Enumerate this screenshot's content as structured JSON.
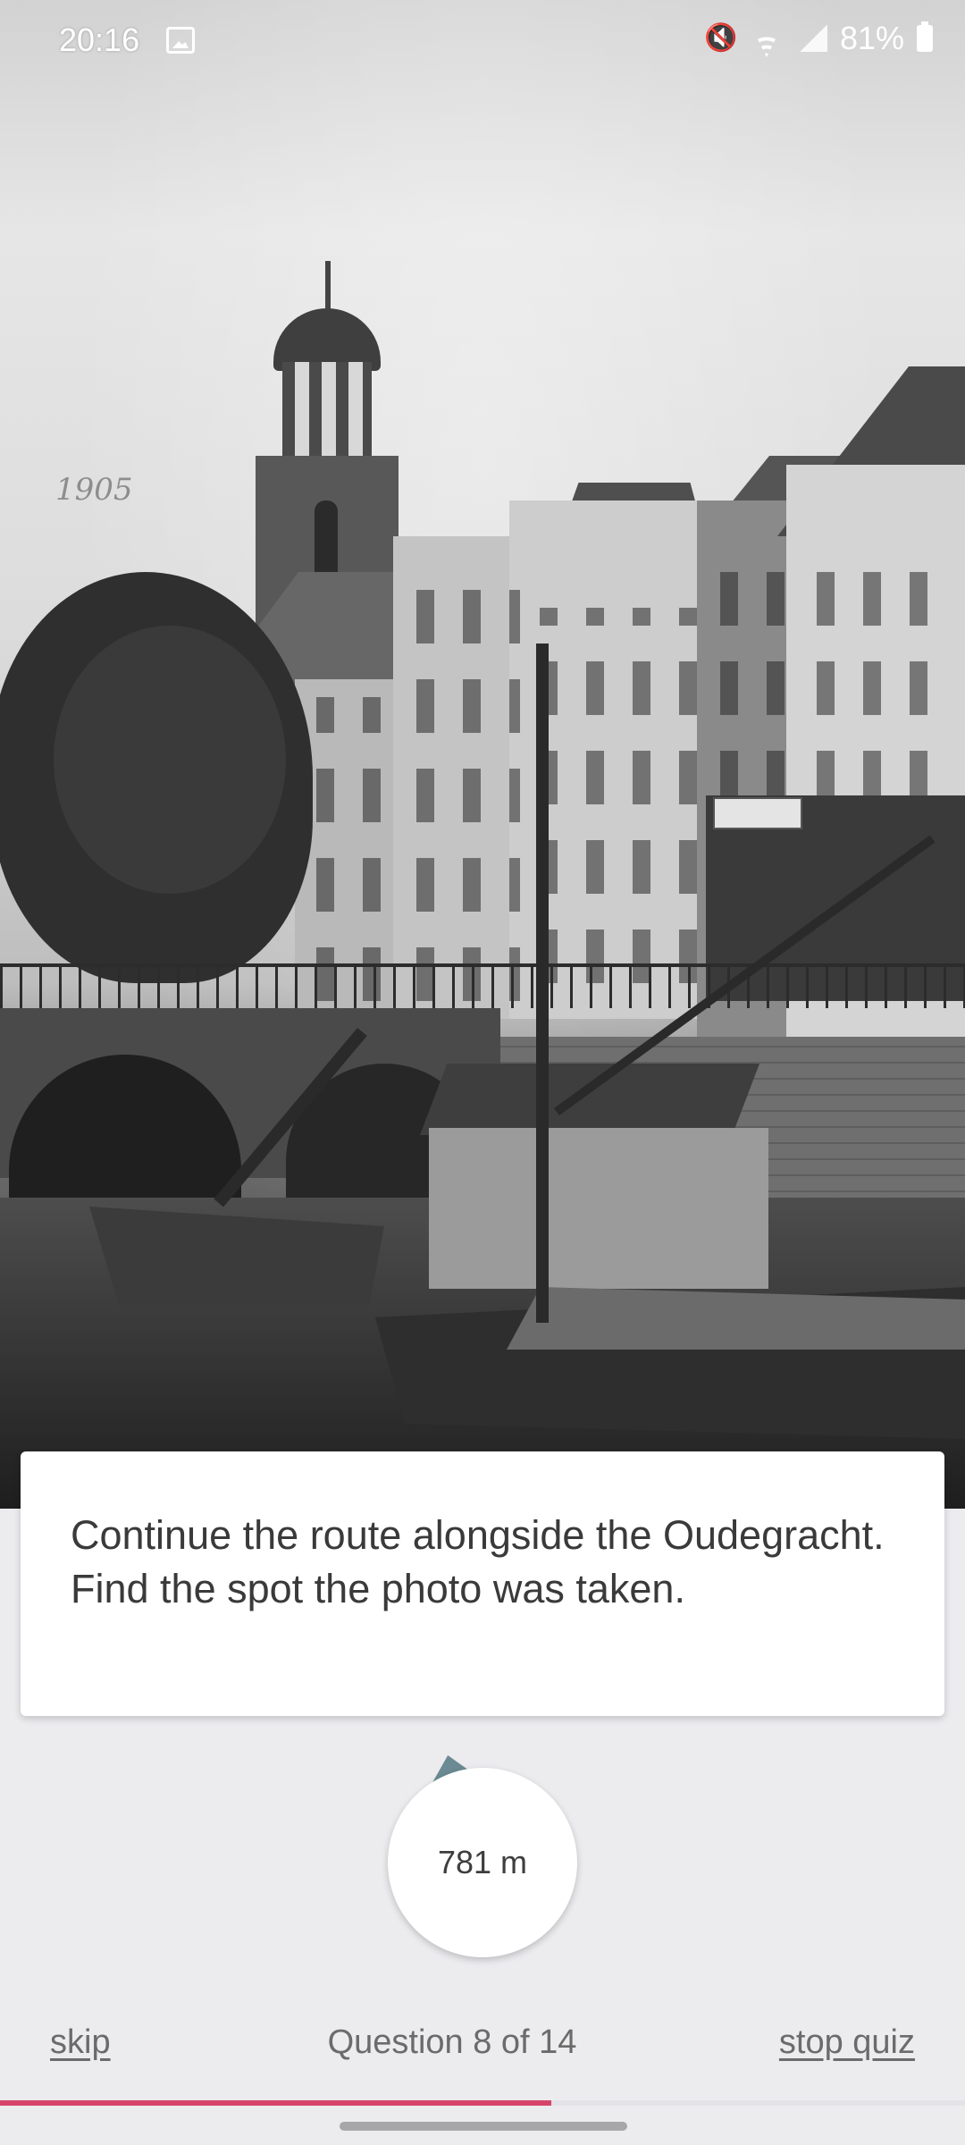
{
  "status_bar": {
    "time": "20:16",
    "battery_percent": "81%",
    "icons": [
      "gallery-icon",
      "mute-icon",
      "wifi-icon",
      "signal-icon",
      "battery-icon"
    ]
  },
  "photo": {
    "year_label": "1905"
  },
  "question": {
    "text": "Continue the route alongside the Oudegracht. Find the spot the photo was taken."
  },
  "distance": {
    "value": "781 m",
    "arrow_color": "#6b8a93"
  },
  "footer": {
    "skip_label": "skip",
    "question_counter": "Question 8 of 14",
    "stop_label": "stop quiz"
  },
  "progress": {
    "current": 8,
    "total": 14,
    "color": "#d6446a"
  }
}
